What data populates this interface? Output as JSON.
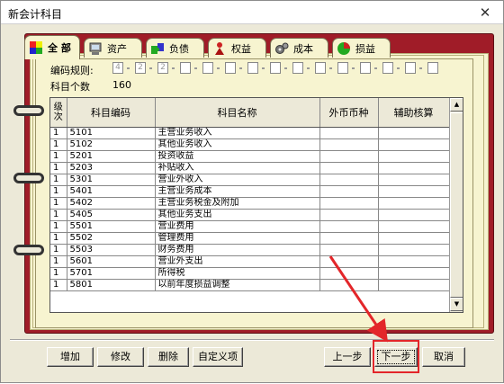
{
  "window": {
    "title": "新会计科目",
    "close_glyph": "✕"
  },
  "tabs": [
    {
      "label": "全 部",
      "icon": "palette-icon",
      "active": true
    },
    {
      "label": "资产",
      "icon": "computer-icon"
    },
    {
      "label": "负债",
      "icon": "puzzle-icon"
    },
    {
      "label": "权益",
      "icon": "person-icon"
    },
    {
      "label": "成本",
      "icon": "gears-icon"
    },
    {
      "label": "损益",
      "icon": "pie-chart-icon"
    }
  ],
  "code_rule": {
    "label": "编码规则:",
    "levels": [
      "4",
      "2",
      "2",
      "",
      "",
      "",
      "",
      "",
      "",
      "",
      "",
      "",
      "",
      "",
      ""
    ]
  },
  "subject_count": {
    "label": "科目个数",
    "value": "160"
  },
  "table": {
    "headers": [
      "级次",
      "科目编码",
      "科目名称",
      "外币币种",
      "辅助核算"
    ],
    "rows": [
      [
        "1",
        "5101",
        "主营业务收入",
        "",
        ""
      ],
      [
        "1",
        "5102",
        "其他业务收入",
        "",
        ""
      ],
      [
        "1",
        "5201",
        "投资收益",
        "",
        ""
      ],
      [
        "1",
        "5203",
        "补贴收入",
        "",
        ""
      ],
      [
        "1",
        "5301",
        "营业外收入",
        "",
        ""
      ],
      [
        "1",
        "5401",
        "主营业务成本",
        "",
        ""
      ],
      [
        "1",
        "5402",
        "主营业务税金及附加",
        "",
        ""
      ],
      [
        "1",
        "5405",
        "其他业务支出",
        "",
        ""
      ],
      [
        "1",
        "5501",
        "营业费用",
        "",
        ""
      ],
      [
        "1",
        "5502",
        "管理费用",
        "",
        ""
      ],
      [
        "1",
        "5503",
        "财务费用",
        "",
        ""
      ],
      [
        "1",
        "5601",
        "营业外支出",
        "",
        ""
      ],
      [
        "1",
        "5701",
        "所得税",
        "",
        ""
      ],
      [
        "1",
        "5801",
        "以前年度损益调整",
        "",
        ""
      ]
    ]
  },
  "buttons": {
    "add": "增加",
    "edit": "修改",
    "delete": "删除",
    "custom": "自定义项",
    "prev": "上一步",
    "next": "下一步",
    "cancel": "取消"
  },
  "colors": {
    "cover": "#a01c28",
    "page": "#f7f4d0",
    "highlight": "#e3262a"
  }
}
